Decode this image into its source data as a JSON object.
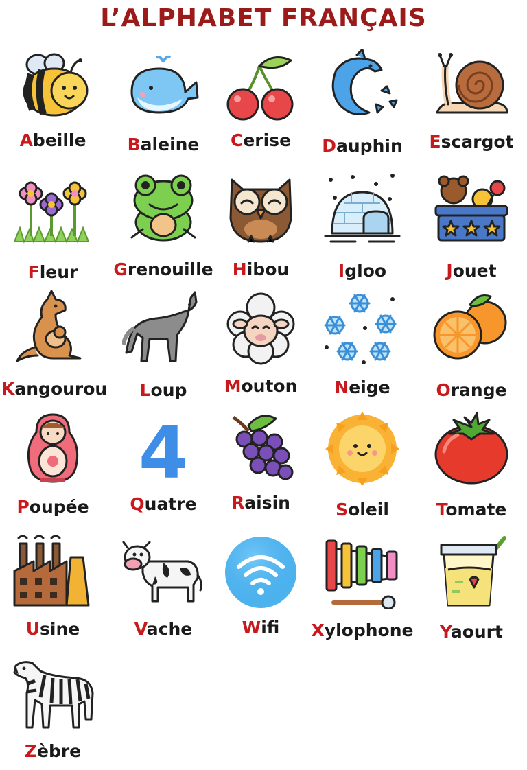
{
  "title": "L’ALPHABET FRANÇAIS",
  "accent_color": "#c8191d",
  "title_color": "#9b1b1b",
  "items": [
    {
      "first": "A",
      "rest": "beille",
      "icon": "bee-icon"
    },
    {
      "first": "B",
      "rest": "aleine",
      "icon": "whale-icon"
    },
    {
      "first": "C",
      "rest": "erise",
      "icon": "cherry-icon"
    },
    {
      "first": "D",
      "rest": "auphin",
      "icon": "dolphin-icon"
    },
    {
      "first": "E",
      "rest": "scargot",
      "icon": "snail-icon"
    },
    {
      "first": "F",
      "rest": "leur",
      "icon": "flowers-icon"
    },
    {
      "first": "G",
      "rest": "renouille",
      "icon": "frog-icon"
    },
    {
      "first": "H",
      "rest": "ibou",
      "icon": "owl-icon"
    },
    {
      "first": "I",
      "rest": "gloo",
      "icon": "igloo-icon"
    },
    {
      "first": "J",
      "rest": "ouet",
      "icon": "toy-box-icon"
    },
    {
      "first": "K",
      "rest": "angourou",
      "icon": "kangaroo-icon"
    },
    {
      "first": "L",
      "rest": "oup",
      "icon": "wolf-icon"
    },
    {
      "first": "M",
      "rest": "outon",
      "icon": "sheep-icon"
    },
    {
      "first": "N",
      "rest": "eige",
      "icon": "snowflakes-icon"
    },
    {
      "first": "O",
      "rest": "range",
      "icon": "orange-icon"
    },
    {
      "first": "P",
      "rest": "oupée",
      "icon": "matryoshka-icon"
    },
    {
      "first": "Q",
      "rest": "uatre",
      "icon": "number-four-icon"
    },
    {
      "first": "R",
      "rest": "aisin",
      "icon": "grapes-icon"
    },
    {
      "first": "S",
      "rest": "oleil",
      "icon": "sun-icon"
    },
    {
      "first": "T",
      "rest": "omate",
      "icon": "tomato-icon"
    },
    {
      "first": "U",
      "rest": "sine",
      "icon": "factory-icon"
    },
    {
      "first": "V",
      "rest": "ache",
      "icon": "cow-icon"
    },
    {
      "first": "W",
      "rest": "ifi",
      "icon": "wifi-icon"
    },
    {
      "first": "X",
      "rest": "ylophone",
      "icon": "xylophone-icon"
    },
    {
      "first": "Y",
      "rest": "aourt",
      "icon": "yogurt-icon"
    },
    {
      "first": "Z",
      "rest": "èbre",
      "icon": "zebra-icon"
    }
  ],
  "four_glyph": "4"
}
